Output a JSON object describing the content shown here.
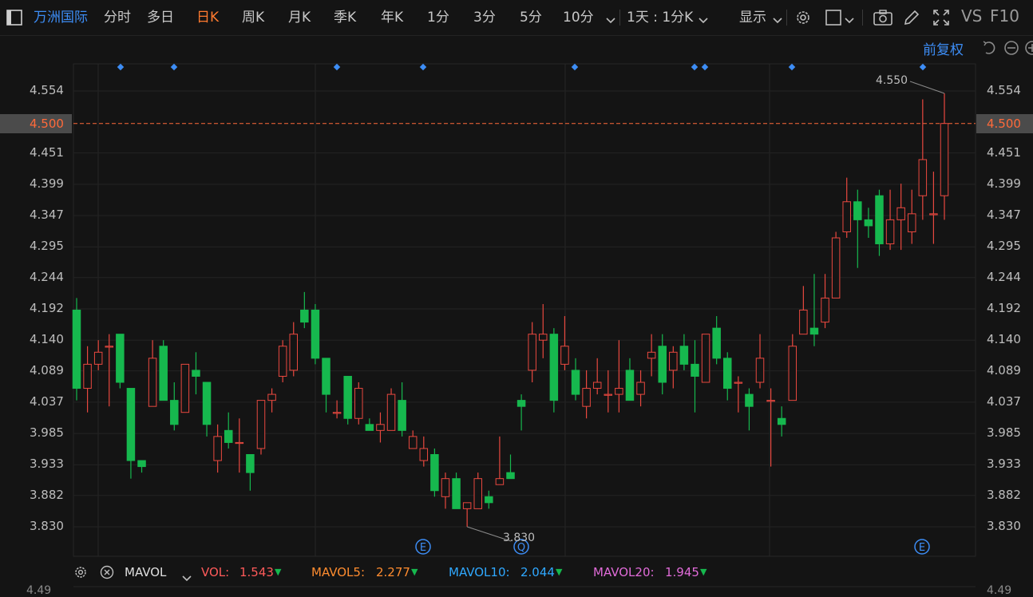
{
  "toolbar": {
    "stock_name": "万洲国际",
    "periods": [
      "分时",
      "多日",
      "日K",
      "周K",
      "月K",
      "季K",
      "年K",
      "1分",
      "3分",
      "5分",
      "10分"
    ],
    "active_period": "日K",
    "interval_dropdown": "1天 : 1分K",
    "display_label": "显示",
    "vs_label": "VS",
    "f10_label": "F10"
  },
  "chart_header": {
    "adjust_label": "前复权"
  },
  "price_axis": {
    "ticks": [
      "4.554",
      "4.500",
      "4.451",
      "4.399",
      "4.347",
      "4.295",
      "4.244",
      "4.192",
      "4.140",
      "4.089",
      "4.037",
      "3.985",
      "3.933",
      "3.882",
      "3.830"
    ],
    "current_price": "4.500",
    "max_label": "4.550",
    "min_label": "3.830"
  },
  "event_markers": [
    "E",
    "Q",
    "E"
  ],
  "indicators": {
    "name": "MAVOL",
    "vol": {
      "label": "VOL:",
      "value": "1.543",
      "color": "#ff5a5a"
    },
    "mavol5": {
      "label": "MAVOL5:",
      "value": "2.277",
      "color": "#ff8c2f"
    },
    "mavol10": {
      "label": "MAVOL10:",
      "value": "2.044",
      "color": "#2fa8ff"
    },
    "mavol20": {
      "label": "MAVOL20:",
      "value": "1.945",
      "color": "#e06bd8"
    }
  },
  "lower_axis": {
    "left": "4.49",
    "right": "4.49"
  },
  "colors": {
    "up": "#e8483f",
    "down": "#16b84e",
    "accent": "#ff7a2f",
    "brand": "#3d8df5"
  },
  "chart_data": {
    "type": "candlestick",
    "y_axis_range": [
      3.83,
      4.554
    ],
    "candles": [
      {
        "o": 4.19,
        "c": 4.06,
        "h": 4.21,
        "l": 4.04
      },
      {
        "o": 4.06,
        "c": 4.1,
        "h": 4.13,
        "l": 4.02
      },
      {
        "o": 4.1,
        "c": 4.12,
        "h": 4.14,
        "l": 4.09
      },
      {
        "o": 4.13,
        "c": 4.13,
        "h": 4.15,
        "l": 4.03
      },
      {
        "o": 4.15,
        "c": 4.07,
        "h": 4.15,
        "l": 4.06
      },
      {
        "o": 4.06,
        "c": 3.94,
        "h": 4.06,
        "l": 3.91
      },
      {
        "o": 3.94,
        "c": 3.93,
        "h": 3.94,
        "l": 3.92
      },
      {
        "o": 4.03,
        "c": 4.11,
        "h": 4.14,
        "l": 4.03
      },
      {
        "o": 4.13,
        "c": 4.04,
        "h": 4.14,
        "l": 4.04
      },
      {
        "o": 4.04,
        "c": 4.0,
        "h": 4.07,
        "l": 3.99
      },
      {
        "o": 4.02,
        "c": 4.1,
        "h": 4.1,
        "l": 4.02
      },
      {
        "o": 4.09,
        "c": 4.08,
        "h": 4.12,
        "l": 4.05
      },
      {
        "o": 4.07,
        "c": 4.0,
        "h": 4.07,
        "l": 3.98
      },
      {
        "o": 3.94,
        "c": 3.98,
        "h": 4.0,
        "l": 3.92
      },
      {
        "o": 3.99,
        "c": 3.97,
        "h": 4.02,
        "l": 3.96
      },
      {
        "o": 3.97,
        "c": 3.97,
        "h": 4.01,
        "l": 3.92
      },
      {
        "o": 3.95,
        "c": 3.92,
        "h": 3.95,
        "l": 3.89
      },
      {
        "o": 3.96,
        "c": 4.04,
        "h": 4.04,
        "l": 3.95
      },
      {
        "o": 4.04,
        "c": 4.05,
        "h": 4.06,
        "l": 4.02
      },
      {
        "o": 4.08,
        "c": 4.13,
        "h": 4.14,
        "l": 4.07
      },
      {
        "o": 4.09,
        "c": 4.15,
        "h": 4.17,
        "l": 4.08
      },
      {
        "o": 4.19,
        "c": 4.17,
        "h": 4.22,
        "l": 4.16
      },
      {
        "o": 4.19,
        "c": 4.11,
        "h": 4.2,
        "l": 4.1
      },
      {
        "o": 4.11,
        "c": 4.05,
        "h": 4.11,
        "l": 4.02
      },
      {
        "o": 4.02,
        "c": 4.02,
        "h": 4.04,
        "l": 4.01
      },
      {
        "o": 4.08,
        "c": 4.01,
        "h": 4.08,
        "l": 4.0
      },
      {
        "o": 4.01,
        "c": 4.06,
        "h": 4.07,
        "l": 4.0
      },
      {
        "o": 4.0,
        "c": 3.99,
        "h": 4.01,
        "l": 3.99
      },
      {
        "o": 3.99,
        "c": 4.0,
        "h": 4.02,
        "l": 3.97
      },
      {
        "o": 3.99,
        "c": 4.05,
        "h": 4.06,
        "l": 3.99
      },
      {
        "o": 4.04,
        "c": 3.99,
        "h": 4.07,
        "l": 3.98
      },
      {
        "o": 3.96,
        "c": 3.98,
        "h": 3.99,
        "l": 3.96
      },
      {
        "o": 3.94,
        "c": 3.96,
        "h": 3.98,
        "l": 3.93
      },
      {
        "o": 3.95,
        "c": 3.89,
        "h": 3.96,
        "l": 3.88
      },
      {
        "o": 3.88,
        "c": 3.91,
        "h": 3.92,
        "l": 3.86
      },
      {
        "o": 3.91,
        "c": 3.86,
        "h": 3.92,
        "l": 3.86
      },
      {
        "o": 3.86,
        "c": 3.87,
        "h": 3.87,
        "l": 3.83
      },
      {
        "o": 3.86,
        "c": 3.91,
        "h": 3.92,
        "l": 3.86
      },
      {
        "o": 3.88,
        "c": 3.87,
        "h": 3.89,
        "l": 3.86
      },
      {
        "o": 3.9,
        "c": 3.91,
        "h": 3.98,
        "l": 3.9
      },
      {
        "o": 3.92,
        "c": 3.91,
        "h": 3.95,
        "l": 3.91
      },
      {
        "o": 4.04,
        "c": 4.03,
        "h": 4.05,
        "l": 3.99
      },
      {
        "o": 4.09,
        "c": 4.15,
        "h": 4.17,
        "l": 4.07
      },
      {
        "o": 4.14,
        "c": 4.15,
        "h": 4.2,
        "l": 4.11
      },
      {
        "o": 4.15,
        "c": 4.04,
        "h": 4.16,
        "l": 4.02
      },
      {
        "o": 4.1,
        "c": 4.13,
        "h": 4.18,
        "l": 4.09
      },
      {
        "o": 4.09,
        "c": 4.05,
        "h": 4.11,
        "l": 4.04
      },
      {
        "o": 4.03,
        "c": 4.06,
        "h": 4.09,
        "l": 4.01
      },
      {
        "o": 4.06,
        "c": 4.07,
        "h": 4.11,
        "l": 4.05
      },
      {
        "o": 4.05,
        "c": 4.05,
        "h": 4.09,
        "l": 4.02
      },
      {
        "o": 4.05,
        "c": 4.06,
        "h": 4.14,
        "l": 4.02
      },
      {
        "o": 4.09,
        "c": 4.04,
        "h": 4.11,
        "l": 4.04
      },
      {
        "o": 4.05,
        "c": 4.07,
        "h": 4.09,
        "l": 4.03
      },
      {
        "o": 4.11,
        "c": 4.12,
        "h": 4.15,
        "l": 4.08
      },
      {
        "o": 4.13,
        "c": 4.07,
        "h": 4.15,
        "l": 4.05
      },
      {
        "o": 4.09,
        "c": 4.12,
        "h": 4.13,
        "l": 4.06
      },
      {
        "o": 4.13,
        "c": 4.1,
        "h": 4.15,
        "l": 4.09
      },
      {
        "o": 4.1,
        "c": 4.08,
        "h": 4.14,
        "l": 4.02
      },
      {
        "o": 4.07,
        "c": 4.15,
        "h": 4.15,
        "l": 4.07
      },
      {
        "o": 4.16,
        "c": 4.11,
        "h": 4.18,
        "l": 4.1
      },
      {
        "o": 4.11,
        "c": 4.06,
        "h": 4.12,
        "l": 4.04
      },
      {
        "o": 4.07,
        "c": 4.07,
        "h": 4.08,
        "l": 4.02
      },
      {
        "o": 4.05,
        "c": 4.03,
        "h": 4.06,
        "l": 3.99
      },
      {
        "o": 4.07,
        "c": 4.11,
        "h": 4.15,
        "l": 4.06
      },
      {
        "o": 4.04,
        "c": 4.04,
        "h": 4.06,
        "l": 3.93
      },
      {
        "o": 4.01,
        "c": 4.0,
        "h": 4.03,
        "l": 3.98
      },
      {
        "o": 4.04,
        "c": 4.13,
        "h": 4.15,
        "l": 4.04
      },
      {
        "o": 4.15,
        "c": 4.19,
        "h": 4.23,
        "l": 4.15
      },
      {
        "o": 4.16,
        "c": 4.15,
        "h": 4.25,
        "l": 4.13
      },
      {
        "o": 4.17,
        "c": 4.21,
        "h": 4.25,
        "l": 4.16
      },
      {
        "o": 4.21,
        "c": 4.31,
        "h": 4.32,
        "l": 4.21
      },
      {
        "o": 4.32,
        "c": 4.37,
        "h": 4.41,
        "l": 4.31
      },
      {
        "o": 4.37,
        "c": 4.34,
        "h": 4.39,
        "l": 4.26
      },
      {
        "o": 4.34,
        "c": 4.33,
        "h": 4.36,
        "l": 4.31
      },
      {
        "o": 4.38,
        "c": 4.3,
        "h": 4.39,
        "l": 4.28
      },
      {
        "o": 4.3,
        "c": 4.34,
        "h": 4.39,
        "l": 4.29
      },
      {
        "o": 4.34,
        "c": 4.36,
        "h": 4.4,
        "l": 4.29
      },
      {
        "o": 4.32,
        "c": 4.35,
        "h": 4.39,
        "l": 4.3
      },
      {
        "o": 4.38,
        "c": 4.44,
        "h": 4.54,
        "l": 4.34
      },
      {
        "o": 4.35,
        "c": 4.35,
        "h": 4.42,
        "l": 4.3
      },
      {
        "o": 4.38,
        "c": 4.5,
        "h": 4.55,
        "l": 4.34
      }
    ]
  }
}
